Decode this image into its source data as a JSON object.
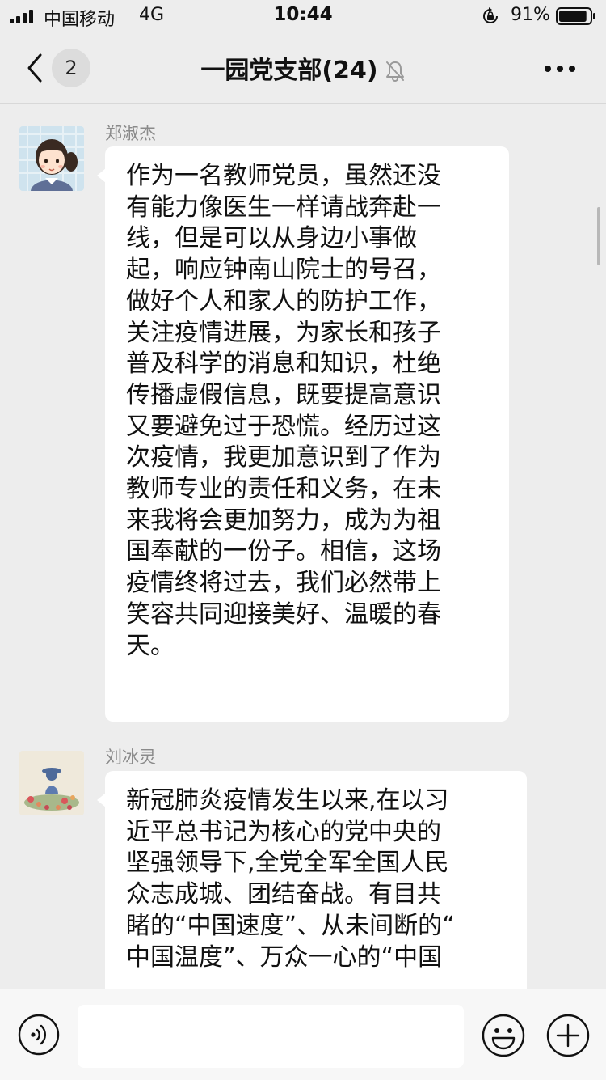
{
  "status_bar": {
    "carrier": "中国移动",
    "network": "4G",
    "time": "10:44",
    "battery_percent": "91%",
    "battery_level": 0.91
  },
  "nav": {
    "unread_count": "2",
    "title": "一园党支部(24)",
    "icons": [
      "chevron-left-icon",
      "bell-muted-icon",
      "more-dots-icon"
    ]
  },
  "messages": [
    {
      "sender": "郑淑杰",
      "avatar": "cartoon-girl-avatar",
      "lines": [
        "作为一名教师党员，虽然还没",
        "有能力像医生一样请战奔赴一",
        "线，但是可以从身边小事做",
        "起，响应钟南山院士的号召，",
        "做好个人和家人的防护工作，",
        "关注疫情进展，为家长和孩子",
        "普及科学的消息和知识，杜绝",
        "传播虚假信息，既要提高意识",
        "又要避免过于恐慌。经历过这",
        "次疫情，我更加意识到了作为",
        "教师专业的责任和义务，在未",
        "来我将会更加努力，成为为祖",
        "国奉献的一份子。相信，这场",
        "疫情终将过去，我们必然带上",
        "笑容共同迎接美好、温暖的春",
        "天。"
      ]
    },
    {
      "sender": "刘冰灵",
      "avatar": "flower-illustration-avatar",
      "lines": [
        "新冠肺炎疫情发生以来,在以习",
        "近平总书记为核心的党中央的",
        "坚强领导下,全党全军全国人民",
        "众志成城、团结奋战。有目共",
        "睹的“中国速度”、从未间断的“",
        "中国温度”、万众一心的“中国"
      ]
    }
  ],
  "input_bar": {
    "placeholder": "",
    "icons": [
      "voice-icon",
      "emoji-icon",
      "plus-icon"
    ]
  },
  "colors": {
    "background": "#ededed",
    "bubble": "#ffffff",
    "sender_name": "#8a8a8a"
  }
}
